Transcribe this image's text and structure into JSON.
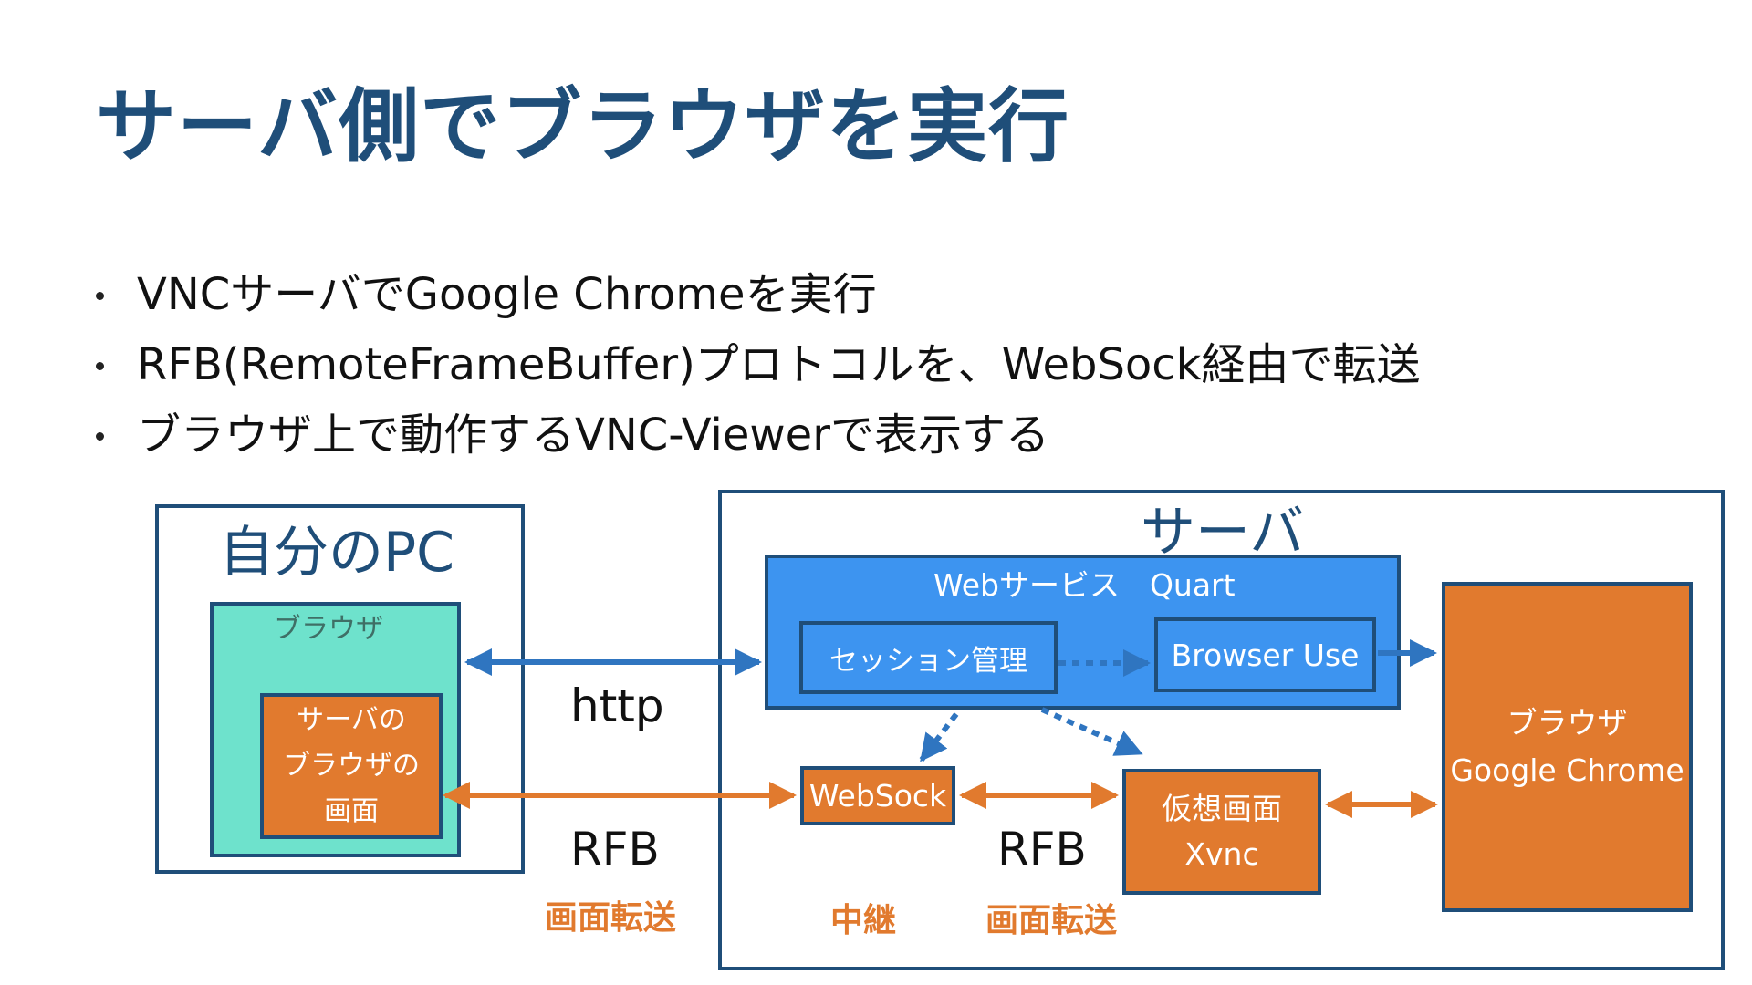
{
  "title": "サーバ側でブラウザを実行",
  "bullets": [
    "VNCサーバでGoogle Chromeを実行",
    "RFB(RemoteFrameBuffer)プロトコルを、WebSock経由で転送",
    "ブラウザ上で動作するVNC-Viewerで表示する"
  ],
  "diagram": {
    "my_pc": {
      "label": "自分のPC",
      "browser_label": "ブラウザ",
      "server_screen_lines": [
        "サーバの",
        "ブラウザの",
        "画面"
      ]
    },
    "server": {
      "label": "サーバ",
      "webservice_label": "Webサービス　Quart",
      "session_label": "セッション管理",
      "browser_use_label": "Browser Use",
      "websock_label": "WebSock",
      "xvnc_lines": [
        "仮想画面",
        "Xvnc"
      ],
      "chrome_lines": [
        "ブラウザ",
        "Google Chrome"
      ]
    },
    "protocols": {
      "http": "http",
      "rfb_left": "RFB",
      "rfb_right": "RFB"
    },
    "notes": {
      "transfer_left": "画面転送",
      "relay": "中継",
      "transfer_right": "画面転送"
    },
    "colors": {
      "title": "#1f4e79",
      "blue_arrow": "#2f75c0",
      "orange": "#e17a2e",
      "teal": "#6ee2cc",
      "webservice_blue": "#3d94f0"
    }
  }
}
